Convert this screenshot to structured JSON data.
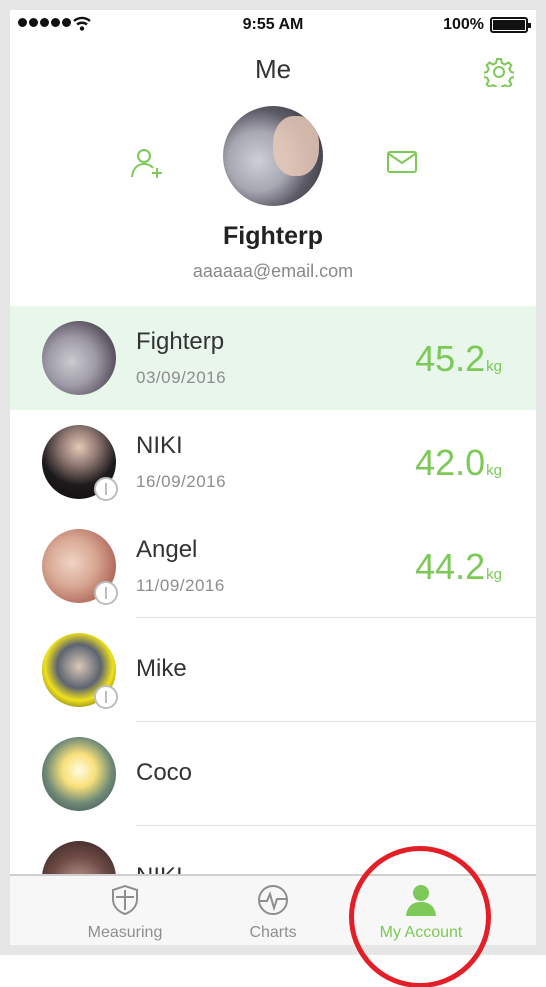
{
  "status_bar": {
    "time": "9:55 AM",
    "battery": "100%"
  },
  "header": {
    "title": "Me"
  },
  "profile": {
    "name": "Fighterp",
    "email": "aaaaaa@email.com"
  },
  "members": [
    {
      "name": "Fighterp",
      "date": "03/09/2016",
      "weight": "45.2",
      "unit": "kg"
    },
    {
      "name": "NIKI",
      "date": "16/09/2016",
      "weight": "42.0",
      "unit": "kg"
    },
    {
      "name": "Angel",
      "date": "11/09/2016",
      "weight": "44.2",
      "unit": "kg"
    },
    {
      "name": "Mike"
    },
    {
      "name": "Coco"
    },
    {
      "name": "NIKI"
    }
  ],
  "tabs": [
    {
      "label": "Measuring",
      "icon": "shield-icon"
    },
    {
      "label": "Charts",
      "icon": "pulse-chart-icon"
    },
    {
      "label": "My Account",
      "icon": "person-icon",
      "active": true
    }
  ],
  "colors": {
    "accent": "#7cc957",
    "highlight_row": "#e8f6ec",
    "annotation": "#e41e26"
  }
}
